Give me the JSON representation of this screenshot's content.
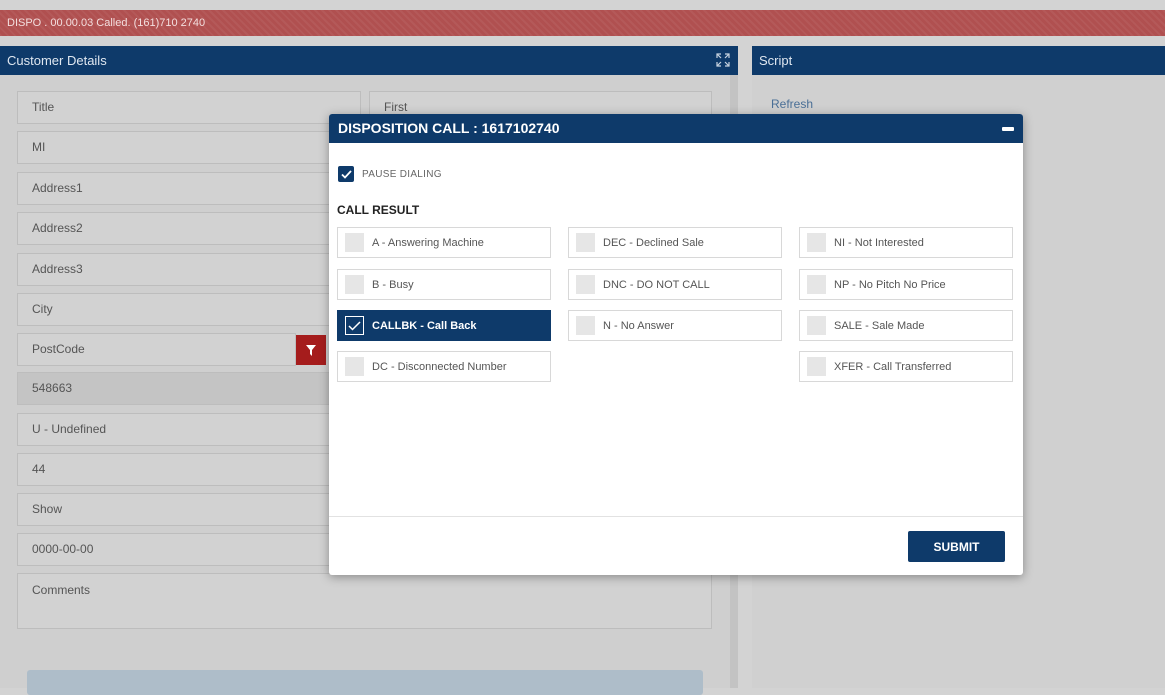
{
  "status_bar": {
    "text": "DISPO . 00.00.03 Called. (161)710 2740"
  },
  "customer_details": {
    "title": "Customer Details",
    "fields": {
      "title": "Title",
      "first": "First",
      "mi": "MI",
      "address1": "Address1",
      "address2": "Address2",
      "address3": "Address3",
      "city": "City",
      "postcode": "PostCode",
      "id_value": "548663",
      "status_value": "U - Undefined",
      "country_code": "44",
      "show": "Show",
      "date": "0000-00-00",
      "comments": "Comments"
    }
  },
  "script_panel": {
    "title": "Script",
    "refresh_label": "Refresh"
  },
  "modal": {
    "title": "DISPOSITION CALL : 1617102740",
    "pause_dialing": {
      "label": "PAUSE DIALING",
      "checked": true
    },
    "call_result_label": "CALL RESULT",
    "options": [
      {
        "code": "A",
        "label": "A - Answering Machine",
        "selected": false
      },
      {
        "code": "DEC",
        "label": "DEC - Declined Sale",
        "selected": false
      },
      {
        "code": "NI",
        "label": "NI - Not Interested",
        "selected": false
      },
      {
        "code": "B",
        "label": "B - Busy",
        "selected": false
      },
      {
        "code": "DNC",
        "label": "DNC - DO NOT CALL",
        "selected": false
      },
      {
        "code": "NP",
        "label": "NP - No Pitch No Price",
        "selected": false
      },
      {
        "code": "CALLBK",
        "label": "CALLBK - Call Back",
        "selected": true
      },
      {
        "code": "N",
        "label": "N - No Answer",
        "selected": false
      },
      {
        "code": "SALE",
        "label": "SALE - Sale Made",
        "selected": false
      },
      {
        "code": "DC",
        "label": "DC - Disconnected Number",
        "selected": false
      },
      {
        "code": "XFER",
        "label": "XFER - Call Transferred",
        "selected": false
      }
    ],
    "submit_label": "SUBMIT"
  },
  "colors": {
    "primary": "#0e3a6a",
    "status_bar": "#b05050",
    "filter_button": "#a51c1c"
  },
  "icons": {
    "expand": "expand-icon",
    "filter": "filter-icon",
    "check": "check-icon",
    "minimize": "minimize-icon"
  }
}
